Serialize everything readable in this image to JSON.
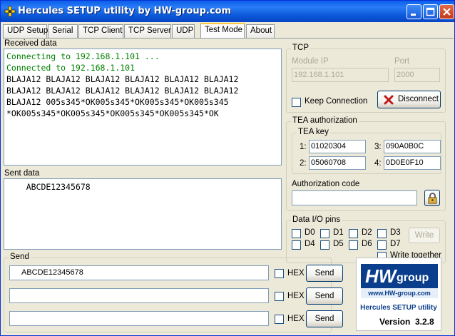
{
  "window": {
    "title": "Hercules SETUP utility by HW-group.com"
  },
  "tabs": [
    {
      "label": "UDP Setup"
    },
    {
      "label": "Serial"
    },
    {
      "label": "TCP Client"
    },
    {
      "label": "TCP Server"
    },
    {
      "label": "UDP"
    },
    {
      "label": "Test Mode"
    },
    {
      "label": "About"
    }
  ],
  "received": {
    "label": "Received data",
    "lines": [
      "Connecting to 192.168.1.101 ...",
      "Connected to 192.168.1.101",
      "BLAJA12 BLAJA12 BLAJA12 BLAJA12 BLAJA12 BLAJA12",
      "BLAJA12 BLAJA12 BLAJA12 BLAJA12 BLAJA12 BLAJA12",
      "BLAJA12 005s345*OK005s345*OK005s345*OK005s345",
      "*OK005s345*OK005s345*OK005s345*OK005s345*OK"
    ],
    "status_color": "#008000"
  },
  "sent": {
    "label": "Sent data",
    "lines": [
      "    ABCDE12345678"
    ]
  },
  "send": {
    "label": "Send",
    "rows": [
      {
        "value": "ABCDE12345678",
        "hex_label": "HEX",
        "button": "Send"
      },
      {
        "value": "",
        "hex_label": "HEX",
        "button": "Send"
      },
      {
        "value": "",
        "hex_label": "HEX",
        "button": "Send"
      }
    ]
  },
  "tcp": {
    "title": "TCP",
    "module_ip_label": "Module IP",
    "module_ip": "192.168.1.101",
    "port_label": "Port",
    "port": "2000",
    "keep_connection": "Keep Connection",
    "disconnect": "Disconnect"
  },
  "tea": {
    "title": "TEA authorization",
    "key_title": "TEA key",
    "keys": [
      {
        "num": "1:",
        "value": "01020304"
      },
      {
        "num": "3:",
        "value": "090A0B0C"
      },
      {
        "num": "2:",
        "value": "05060708"
      },
      {
        "num": "4:",
        "value": "0D0E0F10"
      }
    ],
    "auth_label": "Authorization code",
    "auth_value": ""
  },
  "dio": {
    "title": "Data I/O pins",
    "pins": [
      "D0",
      "D1",
      "D2",
      "D3",
      "D4",
      "D5",
      "D6",
      "D7"
    ],
    "write": "Write",
    "write_together": "Write together"
  },
  "logo": {
    "hw": "HW",
    "group": "group",
    "url": "www.HW-group.com",
    "product": "Hercules SETUP utility",
    "version_label": "Version",
    "version": "3.2.8"
  }
}
